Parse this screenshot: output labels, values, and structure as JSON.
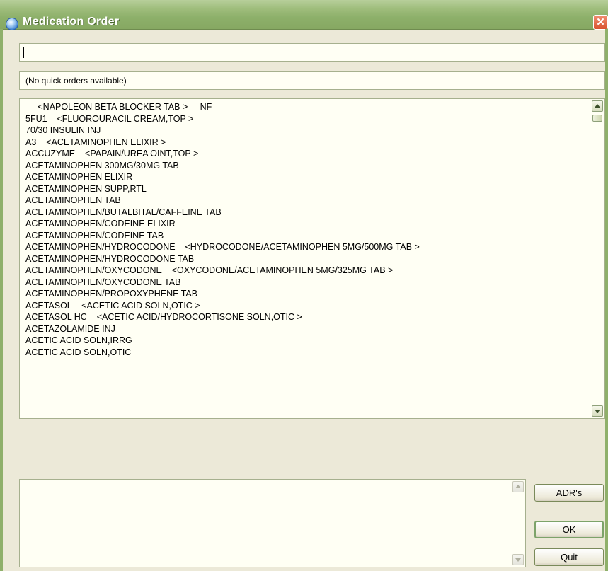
{
  "window": {
    "title": "Medication Order",
    "close_label": "✕"
  },
  "order_input": {
    "value": ""
  },
  "quick_orders": {
    "text": "(No quick orders available)"
  },
  "drug_list": {
    "items": [
      "     <NAPOLEON BETA BLOCKER TAB >     NF",
      "5FU1    <FLUOROURACIL CREAM,TOP >",
      "70/30 INSULIN INJ",
      "A3    <ACETAMINOPHEN ELIXIR >",
      "ACCUZYME    <PAPAIN/UREA OINT,TOP >",
      "ACETAMINOPHEN 300MG/30MG TAB",
      "ACETAMINOPHEN ELIXIR",
      "ACETAMINOPHEN SUPP,RTL",
      "ACETAMINOPHEN TAB",
      "ACETAMINOPHEN/BUTALBITAL/CAFFEINE TAB",
      "ACETAMINOPHEN/CODEINE ELIXIR",
      "ACETAMINOPHEN/CODEINE TAB",
      "ACETAMINOPHEN/HYDROCODONE    <HYDROCODONE/ACETAMINOPHEN 5MG/500MG TAB >",
      "ACETAMINOPHEN/HYDROCODONE TAB",
      "ACETAMINOPHEN/OXYCODONE    <OXYCODONE/ACETAMINOPHEN 5MG/325MG TAB >",
      "ACETAMINOPHEN/OXYCODONE TAB",
      "ACETAMINOPHEN/PROPOXYPHENE TAB",
      "ACETASOL    <ACETIC ACID SOLN,OTIC >",
      "ACETASOL HC    <ACETIC ACID/HYDROCORTISONE SOLN,OTIC >",
      "ACETAZOLAMIDE INJ",
      "ACETIC ACID SOLN,IRRG",
      "ACETIC ACID SOLN,OTIC"
    ]
  },
  "buttons": {
    "adr": "ADR's",
    "ok": "OK",
    "quit": "Quit"
  }
}
